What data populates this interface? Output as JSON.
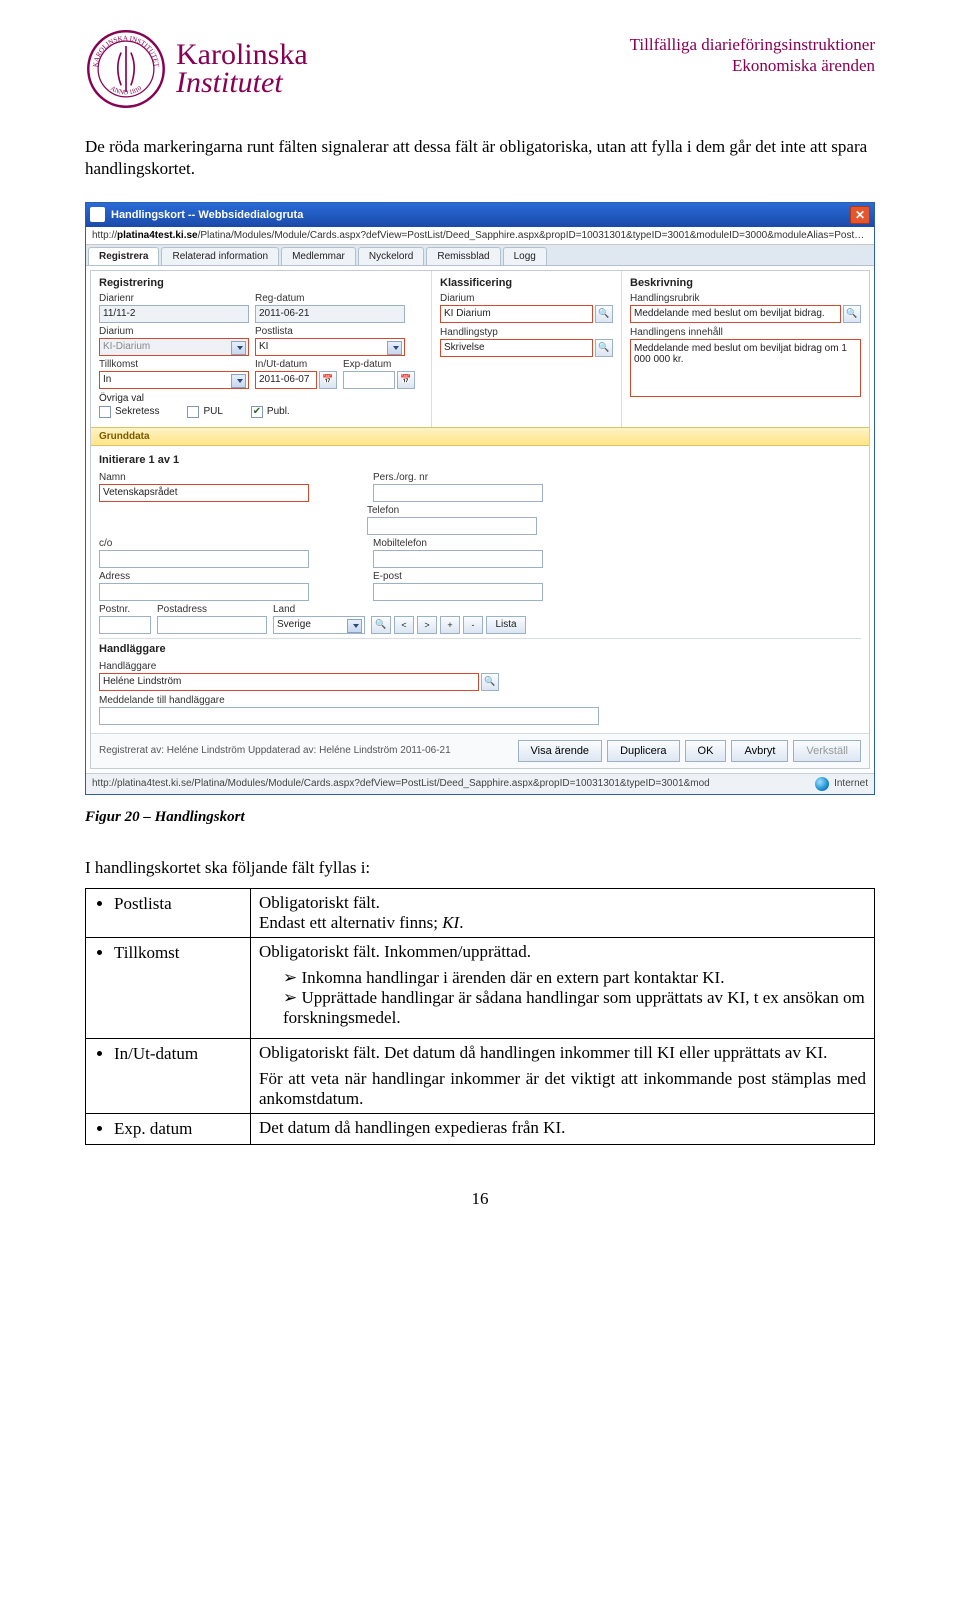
{
  "doc": {
    "brand1": "Karolinska",
    "brand2": "Institutet",
    "hdr1": "Tillfälliga diarieföringsinstruktioner",
    "hdr2": "Ekonomiska ärenden",
    "para1": "De röda markeringarna runt fälten signalerar att dessa fält är obligatoriska, utan att fylla i dem går det inte att spara handlingskortet.",
    "figcap": "Figur 20 – Handlingskort",
    "intro": "I handlingskortet ska följande fält fyllas i:",
    "pagenum": "16"
  },
  "dlg": {
    "title": "Handlingskort -- Webbsidedialogruta",
    "url_host": "platina4test.ki.se",
    "url_rest": "/Platina/Modules/Module/Cards.aspx?defView=PostList/Deed_Sapphire.aspx&propID=10031301&typeID=3001&moduleID=3000&moduleAlias=PostList&hasFullControl=1&l",
    "tabs": [
      "Registrera",
      "Relaterad information",
      "Medlemmar",
      "Nyckelord",
      "Remissblad",
      "Logg"
    ],
    "reg": {
      "title": "Registrering",
      "diarienr_l": "Diarienr",
      "diarienr": "11/11-2",
      "regdatum_l": "Reg-datum",
      "regdatum": "2011-06-21",
      "diarium_l": "Diarium",
      "diarium": "KI-Diarium",
      "postlista_l": "Postlista",
      "postlista": "KI",
      "tillkomst_l": "Tillkomst",
      "tillkomst": "In",
      "inut_l": "In/Ut-datum",
      "inut": "2011-06-07",
      "exp_l": "Exp-datum",
      "exp": "",
      "ovriga_l": "Övriga val",
      "sekretess": "Sekretess",
      "pul": "PUL",
      "publ": "Publ."
    },
    "klass": {
      "title": "Klassificering",
      "diarium_l": "Diarium",
      "diarium": "KI Diarium",
      "htyp_l": "Handlingstyp",
      "htyp": "Skrivelse"
    },
    "besk": {
      "title": "Beskrivning",
      "rubrik_l": "Handlingsrubrik",
      "rubrik": "Meddelande med beslut om beviljat bidrag.",
      "innehall_l": "Handlingens innehåll",
      "innehall": "Meddelande med beslut om beviljat bidrag om 1 000 000 kr."
    },
    "grunddata": "Grunddata",
    "init": {
      "h": "Initierare 1 av 1",
      "namn_l": "Namn",
      "namn": "Vetenskapsrådet",
      "org_l": "Pers./org. nr",
      "tel_l": "Telefon",
      "co_l": "c/o",
      "mob_l": "Mobiltelefon",
      "adr_l": "Adress",
      "epost_l": "E-post",
      "postnr_l": "Postnr.",
      "postadr_l": "Postadress",
      "land_l": "Land",
      "land": "Sverige",
      "lista": "Lista"
    },
    "handl": {
      "h": "Handläggare",
      "hl_l": "Handläggare",
      "hl": "Heléne Lindström",
      "medd_l": "Meddelande till handläggare"
    },
    "footer": {
      "meta": "Registrerat av: Heléne Lindström  Uppdaterad av: Heléne Lindström  2011-06-21",
      "b1": "Visa ärende",
      "b2": "Duplicera",
      "b3": "OK",
      "b4": "Avbryt",
      "b5": "Verkställ"
    },
    "status": {
      "url": "http://platina4test.ki.se/Platina/Modules/Module/Cards.aspx?defView=PostList/Deed_Sapphire.aspx&propID=10031301&typeID=3001&mod",
      "zone": "Internet"
    }
  },
  "defs": {
    "postlista_k": "Postlista",
    "postlista_v1": "Obligatoriskt fält.",
    "postlista_v2": "Endast ett alternativ finns; KI.",
    "tillkomst_k": "Tillkomst",
    "tillkomst_v1": "Obligatoriskt fält. Inkommen/upprättad.",
    "tillkomst_b1": "Inkomna handlingar i ärenden där en extern part kontaktar KI.",
    "tillkomst_b2": "Upprättade handlingar är sådana handlingar som upprättats av KI, t ex ansökan om forskningsmedel.",
    "inut_k": "In/Ut-datum",
    "inut_v1": "Obligatoriskt fält. Det datum då handlingen inkommer till KI eller upprättats av KI.",
    "inut_v2": "För att veta när handlingar inkommer är det viktigt att inkommande post stämplas med ankomstdatum.",
    "exp_k": "Exp. datum",
    "exp_v": "Det datum då handlingen expedieras från KI."
  }
}
